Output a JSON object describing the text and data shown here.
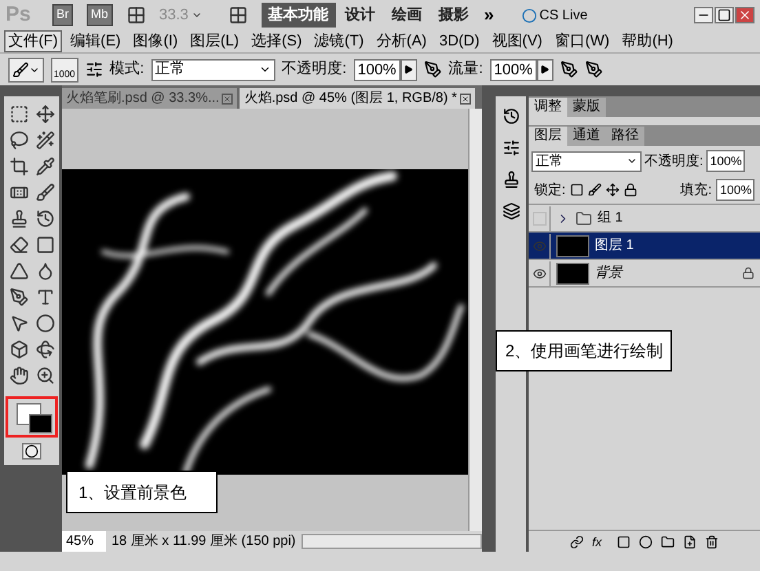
{
  "app_bar": {
    "logo": "Ps",
    "bridge": "Br",
    "mini_bridge": "Mb",
    "zoom": "33.3",
    "more": "»",
    "cs_live": "CS Live",
    "workspaces": [
      {
        "label": "基本功能",
        "selected": true
      },
      {
        "label": "设计",
        "selected": false
      },
      {
        "label": "绘画",
        "selected": false
      },
      {
        "label": "摄影",
        "selected": false
      }
    ]
  },
  "menu": [
    {
      "label": "文件(F)",
      "selected": true
    },
    {
      "label": "编辑(E)",
      "selected": false
    },
    {
      "label": "图像(I)",
      "selected": false
    },
    {
      "label": "图层(L)",
      "selected": false
    },
    {
      "label": "选择(S)",
      "selected": false
    },
    {
      "label": "滤镜(T)",
      "selected": false
    },
    {
      "label": "分析(A)",
      "selected": false
    },
    {
      "label": "3D(D)",
      "selected": false
    },
    {
      "label": "视图(V)",
      "selected": false
    },
    {
      "label": "窗口(W)",
      "selected": false
    },
    {
      "label": "帮助(H)",
      "selected": false
    }
  ],
  "options": {
    "brush_size": "1000",
    "mode_label": "模式:",
    "mode": "正常",
    "opacity_label": "不透明度:",
    "opacity": "100%",
    "flow_label": "流量:",
    "flow": "100%"
  },
  "documents": [
    {
      "title": "火焰笔刷.psd @ 33.3%...",
      "selected": false
    },
    {
      "title": "火焰.psd @ 45% (图层 1, RGB/8) *",
      "selected": true
    }
  ],
  "status": {
    "zoom": "45%",
    "info": "18 厘米 x 11.99 厘米 (150 ppi)"
  },
  "panels": {
    "top_tabs": [
      {
        "label": "调整",
        "selected": true
      },
      {
        "label": "蒙版",
        "selected": false
      }
    ],
    "layer_tabs": [
      {
        "label": "图层",
        "selected": true
      },
      {
        "label": "通道",
        "selected": false
      },
      {
        "label": "路径",
        "selected": false
      }
    ],
    "fx": "fx",
    "blend_mode": "正常",
    "opacity_label": "不透明度:",
    "opacity": "100%",
    "lock_label": "锁定:",
    "fill_label": "填充:",
    "fill": "100%",
    "layers": [
      {
        "kind": "group",
        "name": "组 1",
        "visible": false,
        "selected": false,
        "locked": false
      },
      {
        "kind": "layer",
        "name": "图层 1",
        "visible": true,
        "selected": true,
        "locked": false
      },
      {
        "kind": "background",
        "name": "背景",
        "visible": true,
        "selected": false,
        "locked": true
      }
    ]
  },
  "callouts": [
    {
      "text": "1、设置前景色"
    },
    {
      "text": "2、使用画笔进行绘制"
    }
  ]
}
